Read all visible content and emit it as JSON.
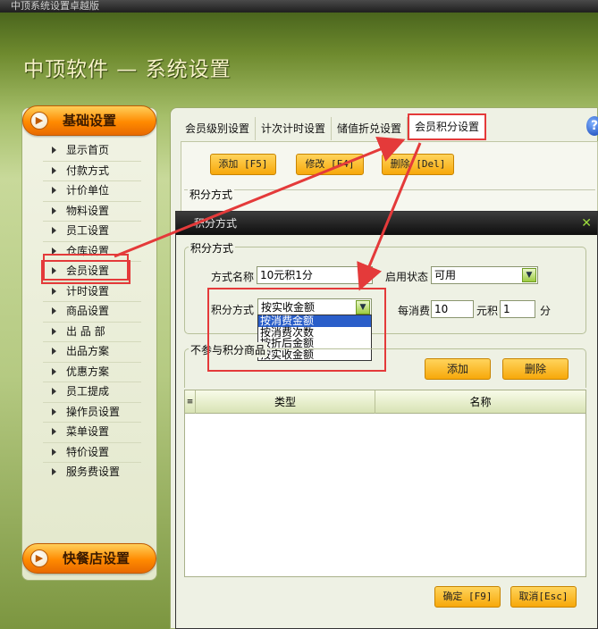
{
  "window": {
    "title": "中顶系统设置卓越版"
  },
  "app": {
    "heading": "中顶软件 — 系统设置"
  },
  "sidebar": {
    "section_top": "基础设置",
    "section_bottom": "快餐店设置",
    "items": [
      {
        "label": "显示首页"
      },
      {
        "label": "付款方式"
      },
      {
        "label": "计价单位"
      },
      {
        "label": "物料设置"
      },
      {
        "label": "员工设置"
      },
      {
        "label": "仓库设置"
      },
      {
        "label": "会员设置",
        "active": true
      },
      {
        "label": "计时设置"
      },
      {
        "label": "商品设置"
      },
      {
        "label": "出 品 部"
      },
      {
        "label": "出品方案"
      },
      {
        "label": "优惠方案"
      },
      {
        "label": "员工提成"
      },
      {
        "label": "操作员设置"
      },
      {
        "label": "菜单设置"
      },
      {
        "label": "特价设置"
      },
      {
        "label": "服务费设置"
      }
    ]
  },
  "tabs": [
    {
      "label": "会员级别设置"
    },
    {
      "label": "计次计时设置"
    },
    {
      "label": "储值折兑设置"
    },
    {
      "label": "会员积分设置",
      "active": true
    }
  ],
  "toolbar": {
    "add": "添加 [F5]",
    "edit": "修改 [F4]",
    "delete": "删除 [Del]"
  },
  "background_panel": {
    "group_label": "积分方式"
  },
  "dialog": {
    "title": "积分方式",
    "close": "✕",
    "group_label": "积分方式",
    "name_label": "方式名称",
    "name_value": "10元积1分",
    "status_label": "启用状态",
    "status_value": "可用",
    "mode_label": "积分方式",
    "mode_value": "按实收金额",
    "mode_options": [
      "按消费金额",
      "按消费次数",
      "按折后金额",
      "按实收金额"
    ],
    "per_spend_label": "每消费",
    "per_spend_value": "10",
    "yuan_label": "元积",
    "points_value": "1",
    "points_unit": "分",
    "exclusion_label": "不参与积分商品",
    "add_button": "添加",
    "delete_button": "删除",
    "grid_columns": [
      "类型",
      "名称"
    ],
    "confirm_button": "确定 [F9]",
    "cancel_button": "取消[Esc]"
  },
  "colors": {
    "accent_orange": "#ff8a00",
    "annotation_red": "#e43a3a",
    "dialog_title_bg": "#1a1a1a",
    "selection_blue": "#2a5ec9"
  }
}
